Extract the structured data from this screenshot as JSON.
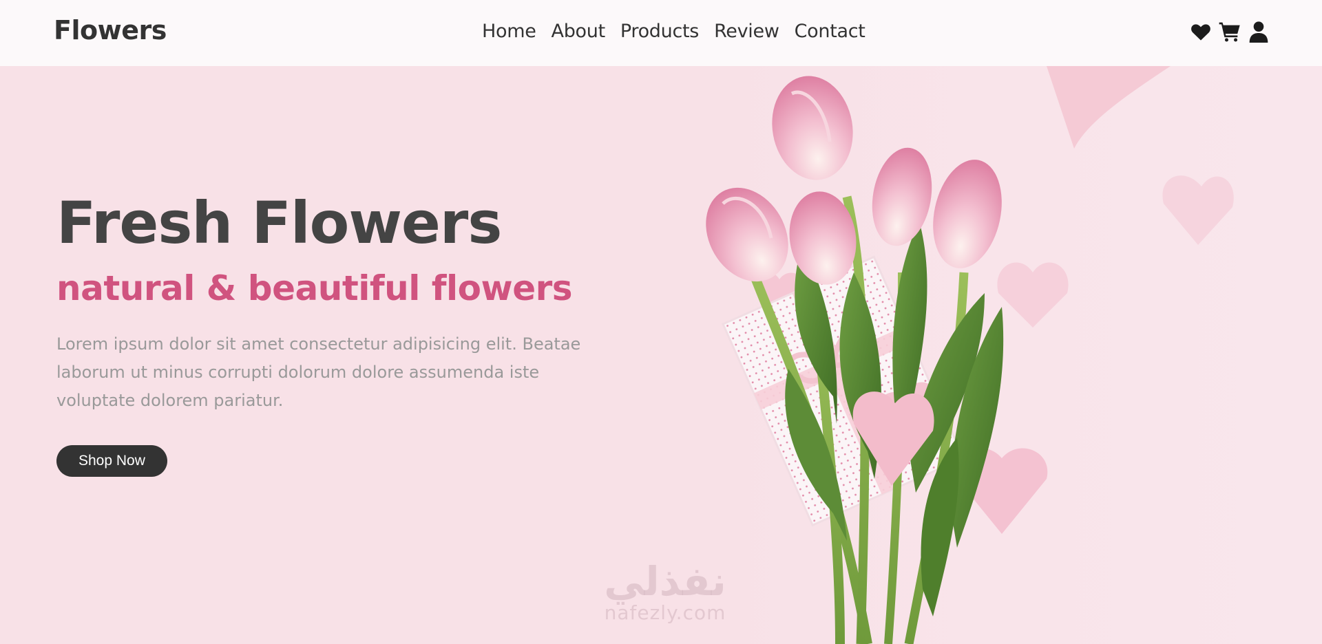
{
  "brand": {
    "name": "Flowers"
  },
  "nav": {
    "items": [
      {
        "label": "Home"
      },
      {
        "label": "About"
      },
      {
        "label": "Products"
      },
      {
        "label": "Review"
      },
      {
        "label": "Contact"
      }
    ]
  },
  "header_icons": [
    "heart-icon",
    "cart-icon",
    "user-icon"
  ],
  "hero": {
    "title": "Fresh Flowers",
    "subtitle": "natural & beautiful flowers",
    "description": "Lorem ipsum dolor sit amet consectetur adipisicing elit. Beatae laborum ut minus corrupti dolorum dolore assumenda iste voluptate dolorem pariatur.",
    "button_label": "Shop Now"
  },
  "watermark": {
    "arabic": "نفذلي",
    "latin": "nafezly.com"
  },
  "colors": {
    "accent": "#d0537f",
    "background": "#f8e1e7",
    "header_bg": "#fcf9fa",
    "text_dark": "#333333",
    "text_muted": "#999999"
  }
}
